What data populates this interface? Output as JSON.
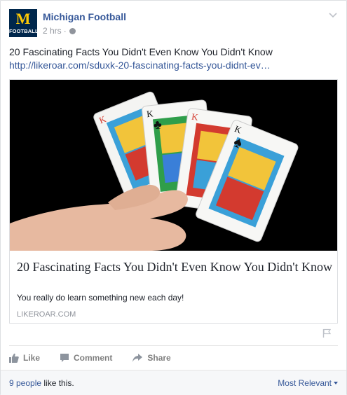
{
  "post": {
    "author": "Michigan Football",
    "avatar_text_top": "M",
    "avatar_text_bottom": "FOOTBALL",
    "time": "2 hrs",
    "separator": "·",
    "text": "20 Fascinating Facts You Didn't Even Know You Didn't Know",
    "link": "http://likeroar.com/sduxk-20-fascinating-facts-you-didnt-ev…"
  },
  "attachment": {
    "image": "hand holding four king playing cards on black background",
    "title": "20 Fascinating Facts You Didn't Even Know You Didn't Know",
    "description": "You really do learn something new each day!",
    "domain": "LIKEROAR.COM"
  },
  "actions": {
    "like": "Like",
    "comment": "Comment",
    "share": "Share"
  },
  "footer": {
    "likes_link": "9 people",
    "likes_suffix": " like this.",
    "sort_label": "Most Relevant"
  },
  "colors": {
    "brand_blue": "#365899",
    "michigan_blue": "#00274c",
    "maize": "#ffcb05",
    "muted": "#90949c"
  },
  "icons": {
    "chevron": "chevron-down-icon",
    "globe": "globe-icon",
    "flag": "flag-icon",
    "like": "thumbs-up-icon",
    "comment": "comment-icon",
    "share": "share-icon"
  }
}
